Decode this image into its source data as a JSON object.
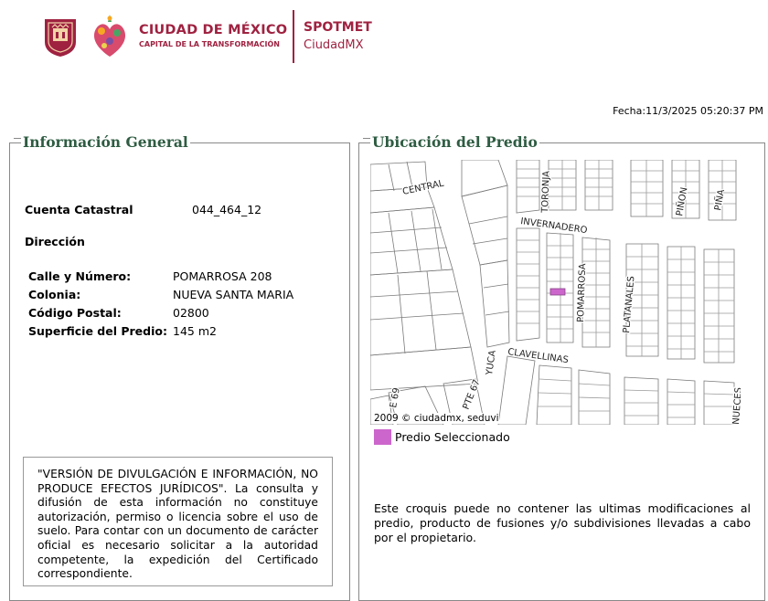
{
  "header": {
    "brand_title": "CIUDAD DE MÉXICO",
    "brand_subtitle": "CAPITAL DE LA TRANSFORMACIÓN",
    "app_title": "SPOTMET",
    "app_subtitle": "CiudadMX",
    "date": "Fecha:11/3/2025 05:20:37 PM",
    "brand_color": "#9f2241"
  },
  "info": {
    "legend": "Información General",
    "cuenta_label": "Cuenta Catastral",
    "cuenta_value": "044_464_12",
    "direccion_label": "Dirección",
    "fields": [
      {
        "label": "Calle y Número:",
        "value": "POMARROSA 208"
      },
      {
        "label": "Colonia:",
        "value": "NUEVA SANTA MARIA"
      },
      {
        "label": "Código Postal:",
        "value": "02800"
      },
      {
        "label": "Superficie del Predio:",
        "value": "145 m2"
      }
    ],
    "notice": "\"VERSIÓN DE DIVULGACIÓN E INFORMACIÓN, NO PRODUCE EFECTOS JURÍDICOS\". La consulta y difusión de esta información no constituye autorización, permiso o licencia sobre el uso de suelo. Para contar con un documento de carácter oficial es necesario solicitar a la autoridad competente, la expedición del Certificado correspondiente."
  },
  "map": {
    "legend": "Ubicación del Predio",
    "street_labels": [
      "CENTRAL",
      "TORONJA",
      "PIÑON",
      "PIÑA",
      "INVERNADERO",
      "POMARROSA",
      "PLATANALES",
      "CLAVELLINAS",
      "YUCA",
      "PTE 67",
      "E 69",
      "NUECES"
    ],
    "copyright": "2009 © ciudadmx, seduvi",
    "legend_item": "Predio Seleccionado",
    "legend_color": "#cc66cc",
    "disclaimer": "Este croquis puede no contener las ultimas modificaciones al predio, producto de fusiones y/o subdivisiones llevadas a cabo por el propietario."
  }
}
